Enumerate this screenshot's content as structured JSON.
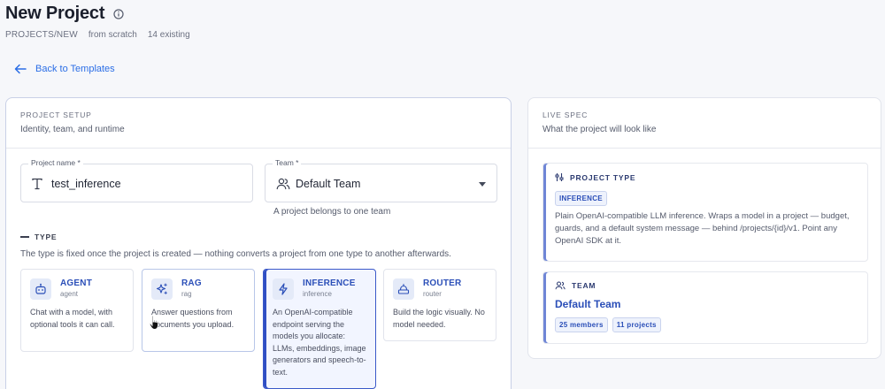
{
  "header": {
    "title": "New Project",
    "path": "PROJECTS/NEW",
    "source": "from scratch",
    "existing": "14 existing"
  },
  "back_link": {
    "label": "Back to Templates"
  },
  "setup": {
    "eyebrow": "PROJECT SETUP",
    "subtitle": "Identity, team, and runtime",
    "project_name": {
      "label": "Project name *",
      "value": "test_inference"
    },
    "team": {
      "label": "Team *",
      "value": "Default Team",
      "helper": "A project belongs to one team"
    },
    "type_section": {
      "label": "TYPE",
      "description": "The type is fixed once the project is created — nothing converts a project from one type to another afterwards."
    },
    "types": [
      {
        "name": "AGENT",
        "slug": "agent",
        "description": "Chat with a model, with optional tools it can call.",
        "icon": "robot-icon"
      },
      {
        "name": "RAG",
        "slug": "rag",
        "description": "Answer questions from documents you upload.",
        "icon": "sparkles-icon"
      },
      {
        "name": "INFERENCE",
        "slug": "inference",
        "description": "An OpenAI-compatible endpoint serving the models you allocate: LLMs, embeddings, image generators and speech-to-text.",
        "icon": "bolt-icon"
      },
      {
        "name": "ROUTER",
        "slug": "router",
        "description": "Build the logic visually. No model needed.",
        "icon": "router-icon"
      }
    ],
    "selected_type": "INFERENCE"
  },
  "spec": {
    "eyebrow": "LIVE SPEC",
    "subtitle": "What the project will look like",
    "project_type": {
      "label": "PROJECT TYPE",
      "badge": "INFERENCE",
      "description": "Plain OpenAI-compatible LLM inference. Wraps a model in a project — budget, guards, and a default system message — behind /projects/{id}/v1. Point any OpenAI SDK at it."
    },
    "team": {
      "label": "TEAM",
      "name": "Default Team",
      "members": "25 members",
      "projects": "11 projects"
    }
  },
  "colors": {
    "accent": "#2b4fb8",
    "link": "#2b6ee6",
    "selected_border": "#3b59c9"
  }
}
